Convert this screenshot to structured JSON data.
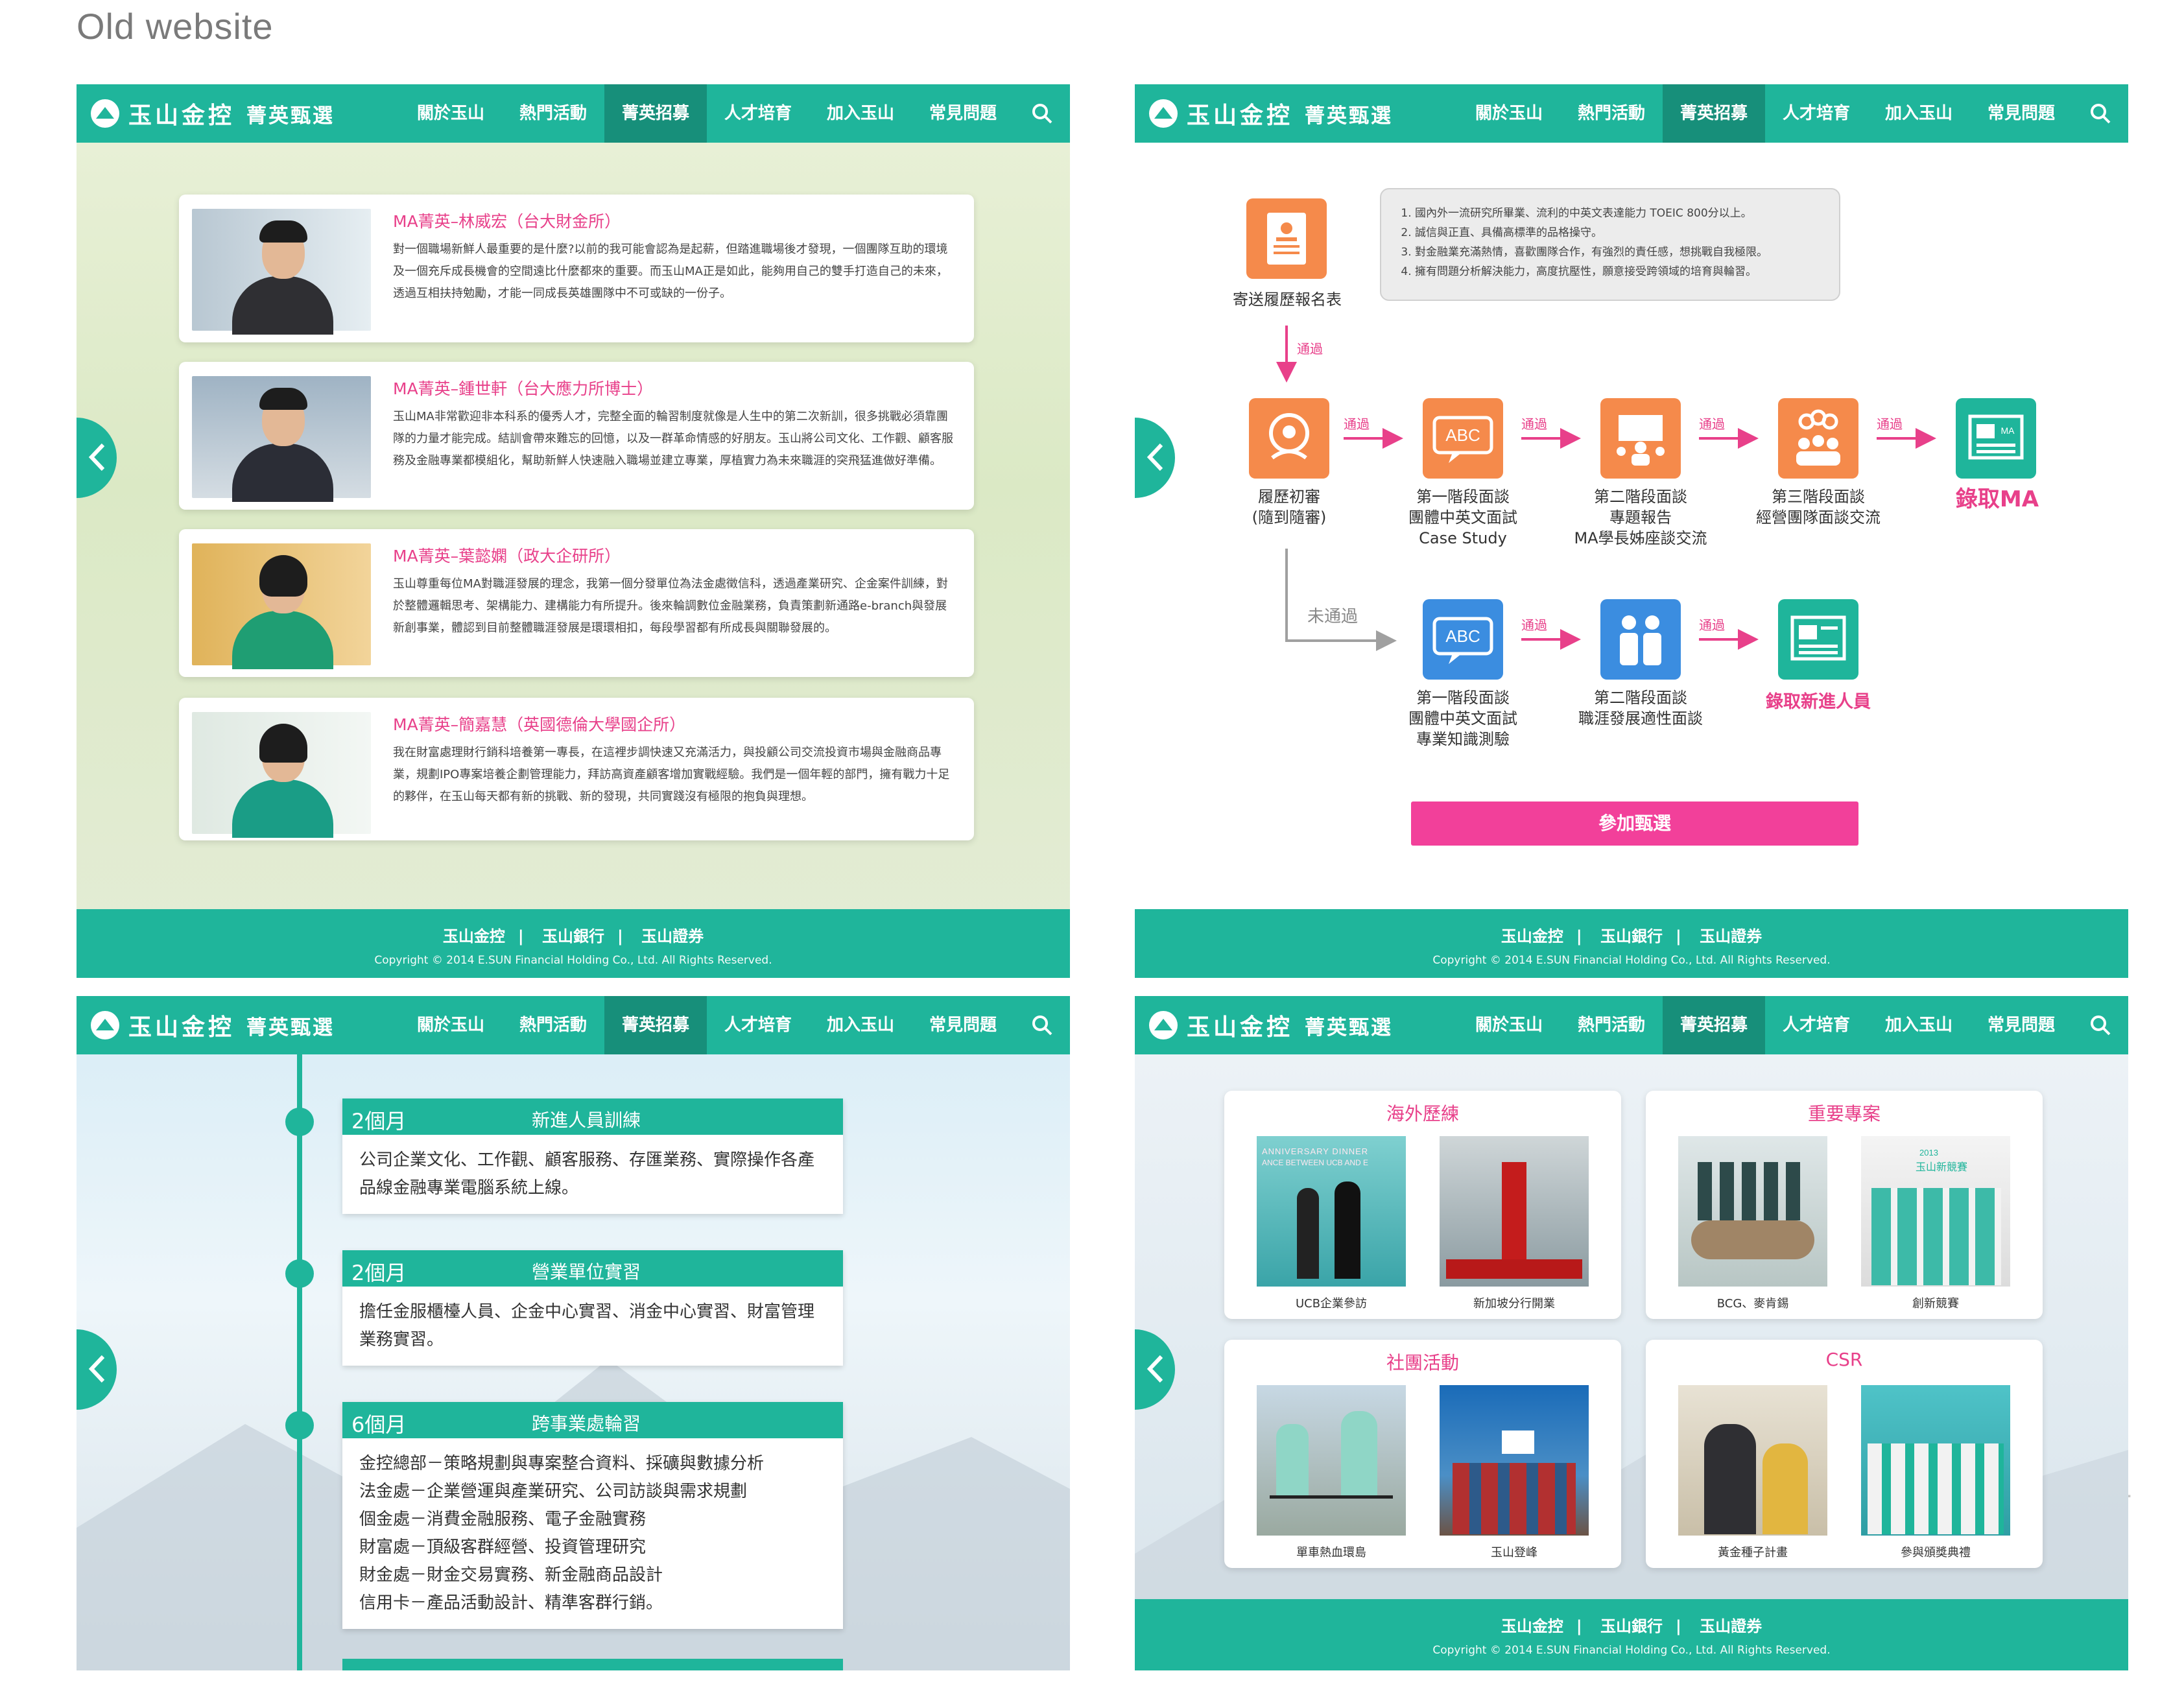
{
  "page_title": "Old website",
  "side_number": "4",
  "header": {
    "logo_text": "玉山金控",
    "logo_sub": "菁英甄選",
    "nav": [
      "關於玉山",
      "熱門活動",
      "菁英招募",
      "人才培育",
      "加入玉山",
      "常見問題"
    ]
  },
  "footer": {
    "links": [
      "玉山金控",
      "玉山銀行",
      "玉山證券"
    ],
    "copyright": "Copyright © 2014 E.SUN Financial Holding Co., Ltd. All Rights Reserved."
  },
  "colors": {
    "teal": "#1fb59b",
    "teal_dark": "#178f7a",
    "pink": "#e8408a",
    "orange": "#f58a4b"
  },
  "testimonials": [
    {
      "name": "MA菁英–林威宏（台大財金所）",
      "text": "對一個職場新鮮人最重要的是什麼?以前的我可能會認為是起薪，但踏進職場後才發現，一個團隊互助的環境及一個充斥成長機會的空間遠比什麼都來的重要。而玉山MA正是如此，能夠用自己的雙手打造自己的未來，透過互相扶持勉勵，才能一同成長英雄團隊中不可或缺的一份子。"
    },
    {
      "name": "MA菁英–鍾世軒（台大應力所博士）",
      "text": "玉山MA非常歡迎非本科系的優秀人才，完整全面的輪習制度就像是人生中的第二次新訓，很多挑戰必須靠團隊的力量才能完成。結訓會帶來難忘的回憶，以及一群革命情感的好朋友。玉山將公司文化、工作觀、顧客服務及金融專業都模組化，幫助新鮮人快速融入職場並建立專業，厚植實力為未來職涯的突飛猛進做好準備。"
    },
    {
      "name": "MA菁英–葉懿嫻（政大企研所）",
      "text": "玉山尊重每位MA對職涯發展的理念，我第一個分發單位為法金處徵信科，透過產業研究、企金案件訓練，對於整體邏輯思考、架構能力、建構能力有所提升。後來輪調數位金融業務，負責策劃新通路e-branch與發展新創事業，體認到目前整體職涯發展是環環相扣，每段學習都有所成長與關聯發展的。"
    },
    {
      "name": "MA菁英–簡嘉慧（英國德倫大學國企所）",
      "text": "我在財富處理財行銷科培養第一專長，在這裡步調快速又充滿活力，與投顧公司交流投資市場與金融商品專業，規劃IPO專案培養企劃管理能力，拜訪高資產顧客增加實戰經驗。我們是一個年輕的部門，擁有戰力十足的夥伴，在玉山每天都有新的挑戰、新的發現，共同實踐沒有極限的抱負與理想。"
    }
  ],
  "process": {
    "apply": "寄送履歷報名表",
    "pass": "通過",
    "fail": "未通過",
    "requirements": [
      "國內外一流研究所畢業、流利的中英文表達能力 TOEIC 800分以上。",
      "誠信與正直、具備高標準的品格操守。",
      "對金融業充滿熱情，喜歡團隊合作，有強烈的責任感，想挑戰自我極限。",
      "擁有問題分析解決能力，高度抗壓性，願意接受跨領域的培育與輪習。"
    ],
    "steps": [
      {
        "lines": [
          "履歷初審",
          "(隨到隨審)"
        ]
      },
      {
        "lines": [
          "第一階段面談",
          "團體中英文面試",
          "Case Study"
        ]
      },
      {
        "lines": [
          "第二階段面談",
          "專題報告",
          "MA學長姊座談交流"
        ]
      },
      {
        "lines": [
          "第三階段面談",
          "經營團隊面談交流"
        ]
      }
    ],
    "result_ma": "錄取MA",
    "alt_steps": [
      {
        "lines": [
          "第一階段面談",
          "團體中英文面試",
          "專業知識測驗"
        ]
      },
      {
        "lines": [
          "第二階段面談",
          "職涯發展適性面談"
        ]
      }
    ],
    "result_new": "錄取新進人員",
    "abc": "ABC",
    "ma_badge": "MA",
    "button": "參加甄選"
  },
  "timeline": [
    {
      "duration": "2個月",
      "title": "新進人員訓練",
      "lines": [
        "公司企業文化、工作觀、顧客服務、存匯業務、實際操作各產",
        "品線金融專業電腦系統上線。"
      ]
    },
    {
      "duration": "2個月",
      "title": "營業單位實習",
      "lines": [
        "擔任金服櫃檯人員、企金中心實習、消金中心實習、財富管理",
        "業務實習。"
      ]
    },
    {
      "duration": "6個月",
      "title": "跨事業處輪習",
      "lines": [
        "金控總部－策略規劃與專案整合資料、採礦與數據分析",
        "法金處－企業營運與產業研究、公司訪談與需求規劃",
        "個金處－消費金融服務、電子金融實務",
        "財富處－頂級客群經營、投資管理研究",
        "財金處－財金交易實務、新金融商品設計",
        "信用卡－產品活動設計、精準客群行銷。"
      ]
    }
  ],
  "gallery": [
    {
      "title": "海外歷練",
      "captions": [
        "UCB企業參訪",
        "新加坡分行開業"
      ]
    },
    {
      "title": "重要專案",
      "captions": [
        "BCG、麥肯錫",
        "創新競賽"
      ]
    },
    {
      "title": "社團活動",
      "captions": [
        "單車熱血環島",
        "玉山登峰"
      ]
    },
    {
      "title": "CSR",
      "captions": [
        "黃金種子計畫",
        "參與頒獎典禮"
      ]
    }
  ],
  "gallery_img_text": {
    "banner": "ANNIVERSARY DINNER",
    "banner2": "ANCE BETWEEN UCB AND E",
    "year": "2013",
    "slogan": "玉山新競賽"
  }
}
